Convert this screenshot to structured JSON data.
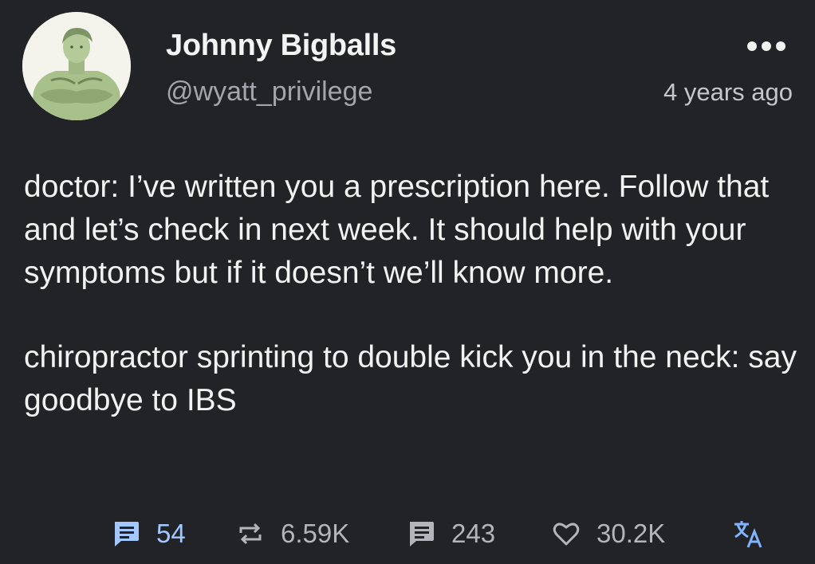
{
  "post": {
    "author": {
      "display_name": "Johnny Bigballs",
      "handle": "@wyatt_privilege",
      "avatar_icon": "avatar-image"
    },
    "timestamp": "4 years ago",
    "more_icon": "more-dots-icon",
    "body": [
      "doctor: I’ve written you a prescription here. Follow that and let’s check in next week. It should help with your symptoms but if it doesn’t we’ll know more.",
      "chiropractor sprinting to double kick you in the neck: say goodbye to IBS"
    ],
    "actions": {
      "quotes": {
        "icon": "quote-icon",
        "count": "54",
        "color": "#a3c8ff"
      },
      "reblogs": {
        "icon": "reblog-icon",
        "count": "6.59K"
      },
      "replies": {
        "icon": "reply-icon",
        "count": "243"
      },
      "likes": {
        "icon": "heart-icon",
        "count": "30.2K"
      },
      "translate": {
        "icon": "translate-icon"
      }
    }
  },
  "colors": {
    "background": "#222326",
    "text": "#f2f2f2",
    "muted": "#a2a5ab",
    "accent": "#a3c8ff"
  }
}
